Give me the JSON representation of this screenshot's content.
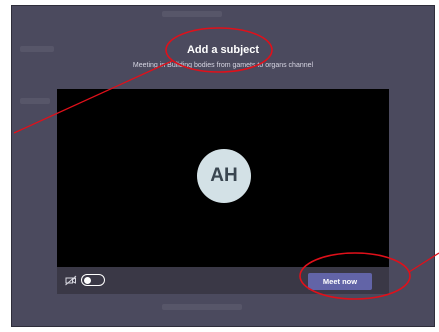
{
  "dialog": {
    "title": "Add a subject",
    "subtitle": "Meeting in Building bodies from gamets to organs channel"
  },
  "avatar": {
    "initials": "AH"
  },
  "controls": {
    "camera_icon": "camera-off-icon",
    "camera_toggle_on": false,
    "meet_now_label": "Meet now"
  },
  "colors": {
    "backdrop": "#4b4a5e",
    "preview": "#000000",
    "avatar_bg": "#d3e1e6",
    "accent": "#6264a7",
    "annotation": "#e0101a"
  }
}
